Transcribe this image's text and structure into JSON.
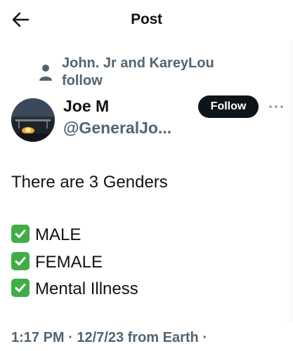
{
  "header": {
    "title": "Post",
    "back_icon": "arrow-left-icon"
  },
  "social_context": {
    "text": "John. Jr and KareyLou follow",
    "icon": "person-icon"
  },
  "author": {
    "display_name": "Joe M",
    "handle": "@GeneralJo..."
  },
  "follow_button": {
    "label": "Follow"
  },
  "more_icon": "ellipsis-icon",
  "tweet": {
    "lines": [
      "There are 3 Genders",
      "MALE",
      "FEMALE",
      "Mental Illness"
    ]
  },
  "meta": {
    "text": "1:17 PM · 12/7/23 from Earth ·"
  },
  "colors": {
    "text": "#0f1419",
    "secondary": "#536471",
    "check_green": "#3fae45"
  }
}
